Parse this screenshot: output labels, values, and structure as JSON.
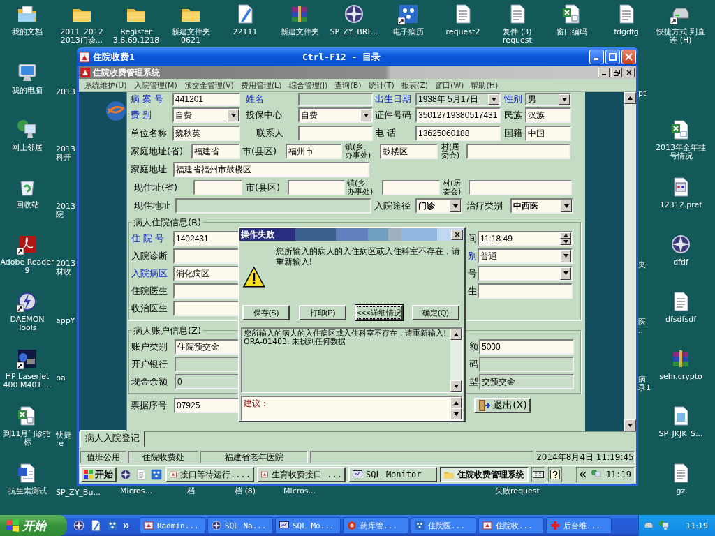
{
  "desktop": {
    "top_row": [
      {
        "label": "我的文档",
        "kind": "docs"
      },
      {
        "label": "2011_2012 2013门诊...",
        "kind": "folder"
      },
      {
        "label": "Register 3.6.69.1218",
        "kind": "folder"
      },
      {
        "label": "新建文件夹 0621",
        "kind": "folder"
      },
      {
        "label": "22111",
        "kind": "pen"
      },
      {
        "label": "新建文件夹",
        "kind": "rar"
      },
      {
        "label": "SP_ZY_BRF...",
        "kind": "compass"
      },
      {
        "label": "电子病历",
        "kind": "app",
        "shortcut": true
      },
      {
        "label": "request2",
        "kind": "note"
      },
      {
        "label": "复件 (3) request",
        "kind": "note"
      },
      {
        "label": "窗口编码",
        "kind": "excel"
      },
      {
        "label": "fdgdfg",
        "kind": "note"
      },
      {
        "label": "快捷方式 到直连 (H)",
        "kind": "drive",
        "shortcut": true
      }
    ],
    "left_column": [
      {
        "label": "我的电脑",
        "kind": "computer"
      },
      {
        "label": "网上邻居",
        "kind": "network"
      },
      {
        "label": "回收站",
        "kind": "recycle"
      },
      {
        "label": "Adobe Reader 9",
        "kind": "pdf",
        "shortcut": true
      },
      {
        "label": "DAEMON Tools",
        "kind": "daemon",
        "shortcut": true
      },
      {
        "label": "HP LaserJet 400 M401 ...",
        "kind": "printer",
        "shortcut": true
      },
      {
        "label": "到11月门诊指标",
        "kind": "excel"
      },
      {
        "label": "抗生素测试",
        "kind": "word"
      }
    ],
    "second_column_labels": [
      "2013",
      "2013 科开",
      "2013 院",
      "2013 材收",
      "appY",
      "ba",
      "快捷 re",
      "SP_ZY_Bu..."
    ],
    "right_column": [
      {
        "label": "2013年全年挂号情况",
        "kind": "excel"
      },
      {
        "label": "12312.pref",
        "kind": "pref"
      },
      {
        "label": "dfdf",
        "kind": "compass"
      },
      {
        "label": "dfsdfsdf",
        "kind": "note"
      },
      {
        "label": "sehr.crypto",
        "kind": "rar"
      },
      {
        "label": "SP_JKJK_S...",
        "kind": "file"
      },
      {
        "label": "gz",
        "kind": "note"
      }
    ],
    "right_fragments": [
      "pt",
      "夹",
      "医 ..",
      "病录1"
    ],
    "bottom_fragments": [
      "Micros...",
      "档",
      "档 (8)",
      "Micros...",
      "失败request"
    ]
  },
  "window": {
    "title": "住院收费1",
    "caption": "Ctrl-F12 - 目录",
    "app_title": "住院收费管理系统",
    "menu": [
      "系统维护(U)",
      "入院管理(M)",
      "预交金管理(V)",
      "费用管理(L)",
      "综合管理(J)",
      "查询(B)",
      "统计(T)",
      "报表(Z)",
      "窗口(W)",
      "帮助(H)"
    ],
    "form": {
      "sections": [
        {
          "rows": [
            {
              "fields": [
                {
                  "label": "病 案 号",
                  "required": true,
                  "kind": "field",
                  "value": "441201",
                  "disabled": false
                },
                {
                  "label": "姓名",
                  "required": true,
                  "kind": "field",
                  "disabled": true
                },
                {
                  "label": "出生日期",
                  "required": true,
                  "kind": "select",
                  "value": "1938年 5月17日",
                  "disabled": true
                },
                {
                  "label": "性别",
                  "required": true,
                  "kind": "select",
                  "value": "男",
                  "disabled": true
                }
              ]
            },
            {
              "fields": [
                {
                  "label": "费 别",
                  "required": true,
                  "kind": "select",
                  "value": "自费",
                  "disabled": false
                },
                {
                  "label": "投保中心",
                  "required": false,
                  "kind": "select",
                  "value": "自费",
                  "disabled": false
                },
                {
                  "label": "证件号码",
                  "required": false,
                  "kind": "field",
                  "value": "35012719380517431",
                  "disabled": false
                },
                {
                  "label": "民族",
                  "required": false,
                  "kind": "field",
                  "value": "汉族",
                  "disabled": false
                }
              ]
            },
            {
              "fields": [
                {
                  "label": "单位名称",
                  "required": false,
                  "kind": "field",
                  "value": "魏秋英",
                  "disabled": false
                },
                {
                  "label": "联系人",
                  "required": false,
                  "kind": "field",
                  "disabled": false
                },
                {
                  "label": "电 话",
                  "required": false,
                  "kind": "field",
                  "value": "13625060188",
                  "disabled": false
                },
                {
                  "label": "国籍",
                  "required": false,
                  "kind": "field",
                  "value": "中国",
                  "disabled": false
                }
              ]
            },
            {
              "fields": [
                {
                  "label": "家庭地址(省)",
                  "required": false,
                  "kind": "field",
                  "value": "福建省",
                  "disabled": false
                },
                {
                  "label": "市(县区)",
                  "required": false,
                  "kind": "field",
                  "value": "福州市",
                  "disabled": false
                },
                {
                  "label": "镇(乡、办事处)",
                  "required": false,
                  "kind": "field",
                  "value": "鼓楼区",
                  "disabled": false
                },
                {
                  "label": "村(居委会)",
                  "required": false,
                  "kind": "field",
                  "disabled": false
                }
              ]
            },
            {
              "fields": [
                {
                  "label": "家庭地址",
                  "required": false,
                  "kind": "field",
                  "value": "福建省福州市鼓楼区",
                  "disabled": false
                }
              ]
            },
            {
              "fields": [
                {
                  "label": "现住址(省)",
                  "required": false,
                  "kind": "field",
                  "disabled": false
                },
                {
                  "label": "市(县区)",
                  "required": false,
                  "kind": "field",
                  "disabled": false
                },
                {
                  "label": "镇(乡、办事处)",
                  "required": false,
                  "kind": "field",
                  "disabled": false
                },
                {
                  "label": "村(居委会)",
                  "required": false,
                  "kind": "field",
                  "disabled": false
                }
              ]
            },
            {
              "fields": [
                {
                  "label": "现住地址",
                  "required": false,
                  "kind": "field",
                  "disabled": true
                },
                {
                  "label": "入院途径",
                  "required": false,
                  "kind": "select",
                  "value": "门诊",
                  "bold": true,
                  "disabled": false
                },
                {
                  "label": "治疗类别",
                  "required": false,
                  "kind": "select",
                  "value": "中西医",
                  "bold": true,
                  "disabled": false
                }
              ]
            }
          ]
        },
        {
          "group": "病人住院信息(R)",
          "rows": [
            {
              "fields": [
                {
                  "label": "住 院 号",
                  "required": true,
                  "kind": "field",
                  "value": "1402431",
                  "disabled": false
                },
                {
                  "label": "间",
                  "required": false,
                  "kind": "spinner",
                  "value": "11:18:49",
                  "disabled": false
                }
              ]
            },
            {
              "fields": [
                {
                  "label": "入院诊断",
                  "required": false,
                  "kind": "field",
                  "disabled": false
                },
                {
                  "label": "别",
                  "required": true,
                  "kind": "select",
                  "value": "普通",
                  "disabled": false
                }
              ]
            },
            {
              "fields": [
                {
                  "label": "入院病区",
                  "required": true,
                  "kind": "field",
                  "value": "消化病区",
                  "disabled": false
                },
                {
                  "label": "号",
                  "required": false,
                  "kind": "select",
                  "disabled": false
                }
              ]
            },
            {
              "fields": [
                {
                  "label": "住院医生",
                  "required": false,
                  "kind": "field",
                  "disabled": false
                },
                {
                  "label": "生",
                  "required": false,
                  "kind": "field",
                  "disabled": false
                }
              ]
            },
            {
              "fields": [
                {
                  "label": "收治医生",
                  "required": false,
                  "kind": "field",
                  "disabled": false
                }
              ]
            }
          ]
        },
        {
          "group": "病人账户信息(Z)",
          "rows": [
            {
              "fields": [
                {
                  "label": "账户类别",
                  "required": false,
                  "kind": "field",
                  "value": "住院预交金",
                  "disabled": false
                },
                {
                  "label": "额",
                  "required": false,
                  "kind": "field",
                  "value": "5000",
                  "disabled": false
                }
              ]
            },
            {
              "fields": [
                {
                  "label": "开户银行",
                  "required": false,
                  "kind": "field",
                  "disabled": true
                },
                {
                  "label": "码",
                  "required": false,
                  "kind": "field",
                  "disabled": true
                }
              ]
            },
            {
              "fields": [
                {
                  "label": "现金余额",
                  "required": false,
                  "kind": "field",
                  "value": "0",
                  "disabled": true
                },
                {
                  "label": "型",
                  "required": false,
                  "kind": "field",
                  "value": "交预交金",
                  "disabled": true
                }
              ]
            }
          ]
        },
        {
          "rows": [
            {
              "fields": [
                {
                  "label": "票据序号",
                  "required": false,
                  "kind": "field",
                  "value": "07925",
                  "disabled": false
                },
                {
                  "kind": "button",
                  "text": "退出(X)"
                }
              ]
            }
          ]
        }
      ]
    },
    "dialog": {
      "title": "操作失败",
      "message": "您所输入的病人的入住病区或入住科室不存在，请重新输入!",
      "buttons": [
        {
          "label": "保存(S)",
          "selected": false
        },
        {
          "label": "打印(P)",
          "selected": false
        },
        {
          "label": "<<<详细情况",
          "selected": true
        },
        {
          "label": "确定(Q)",
          "selected": false
        }
      ],
      "details": [
        "您所输入的病人的入住病区或入住科室不存在，请重新输入!",
        "ORA-01403: 未找到任何数据"
      ],
      "suggestion_label": "建议："
    },
    "tabs": [
      {
        "label": "病人入院登记",
        "selected": true
      }
    ],
    "status_bar": {
      "panels": [
        "值班公用",
        "住院收费处",
        "福建省老年医院"
      ],
      "datetime": "2014年8月4日 11:19:45"
    },
    "taskbar": {
      "start": "开始",
      "buttons": [
        {
          "label": "接口等待运行....",
          "selected": false
        },
        {
          "label": "生育收费接口 ...",
          "selected": false
        },
        {
          "label": "SQL Monitor",
          "selected": false
        },
        {
          "label": "住院收费管理系统",
          "selected": true
        }
      ],
      "clock": "11:19"
    }
  },
  "taskbar": {
    "start": "开始",
    "buttons": [
      {
        "label": "Radmin...",
        "kind": "radmin"
      },
      {
        "label": "SQL Na...",
        "kind": "compass"
      },
      {
        "label": "SQL Mo...",
        "kind": "monitor"
      },
      {
        "label": "药库管...",
        "kind": "pill"
      },
      {
        "label": "住院医...",
        "kind": "app"
      },
      {
        "label": "住院收...",
        "kind": "radmin"
      },
      {
        "label": "后台维...",
        "kind": "cross"
      }
    ],
    "clock": "11:19"
  }
}
